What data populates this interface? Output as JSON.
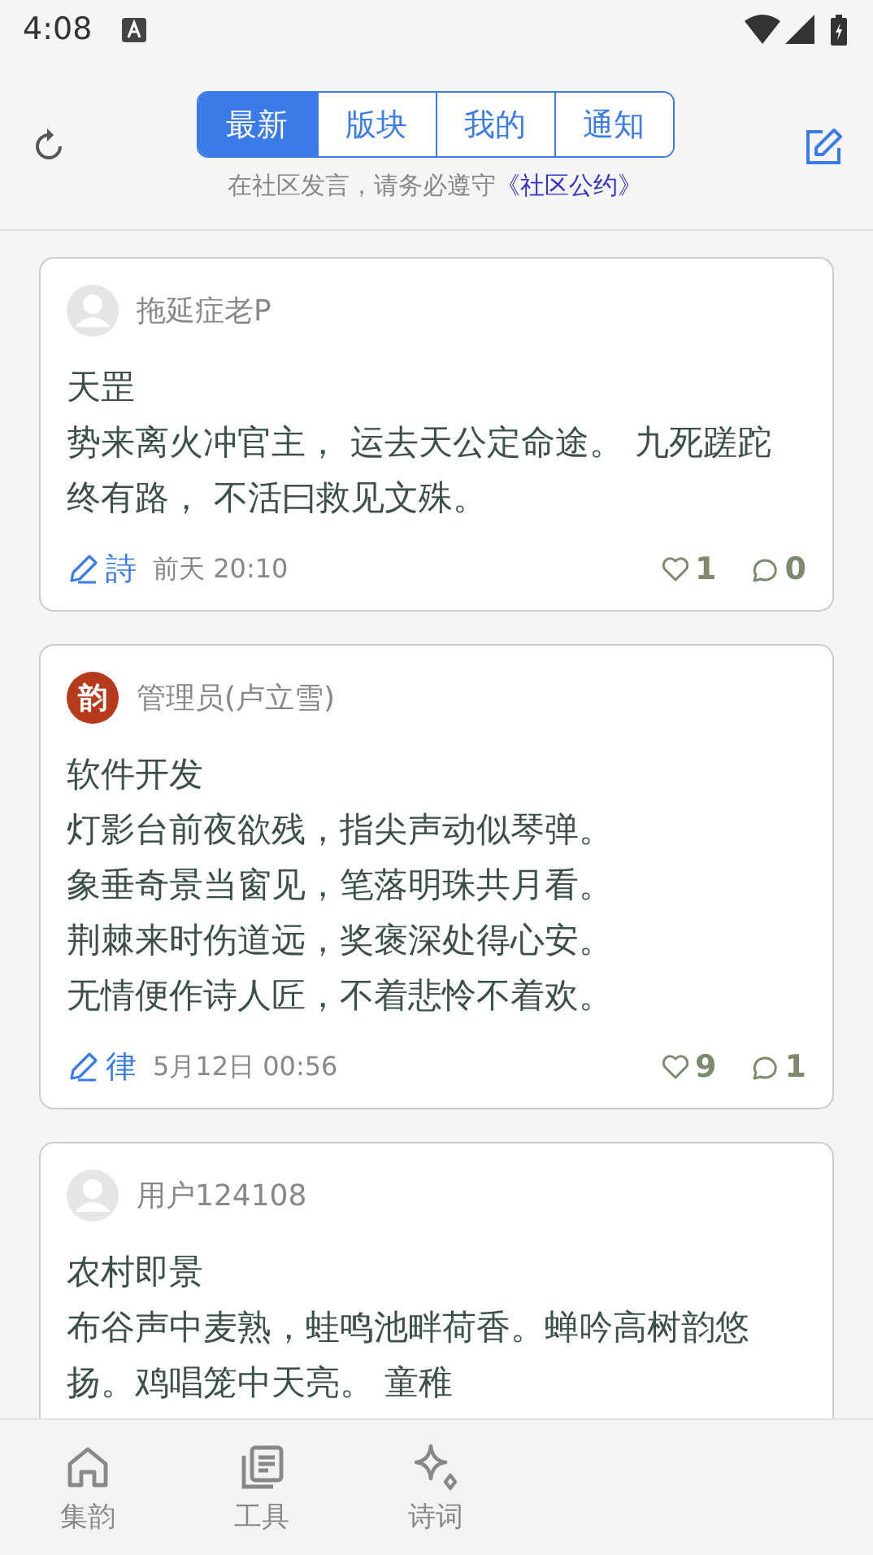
{
  "status_bar": {
    "time": "4:08"
  },
  "header": {
    "tabs": [
      {
        "label": "最新",
        "selected": true
      },
      {
        "label": "版块",
        "selected": false
      },
      {
        "label": "我的",
        "selected": false
      },
      {
        "label": "通知",
        "selected": false
      }
    ],
    "notice": "在社区发言，请务必遵守",
    "notice_link": "《社区公约》"
  },
  "posts": [
    {
      "avatar": {
        "kind": "default"
      },
      "author": "拖延症老P",
      "title": "天罡",
      "lines": [
        "势来离火冲官主， 运去天公定命途。 九死蹉跎终有路， 不活曰救见文殊。"
      ],
      "tag": "詩",
      "time": "前天 20:10",
      "likes": "1",
      "comments": "0"
    },
    {
      "avatar": {
        "kind": "seal",
        "text": "韵"
      },
      "author": "管理员(卢立雪)",
      "title": "软件开发",
      "lines": [
        "灯影台前夜欲残，指尖声动似琴弹。",
        "象垂奇景当窗见，笔落明珠共月看。",
        "荆棘来时伤道远，奖褒深处得心安。",
        "无情便作诗人匠，不着悲怜不着欢。"
      ],
      "tag": "律",
      "time": "5月12日 00:56",
      "likes": "9",
      "comments": "1"
    },
    {
      "avatar": {
        "kind": "default"
      },
      "author": "用户124108",
      "title": "农村即景",
      "lines": [
        "布谷声中麦熟，蛙鸣池畔荷香。蝉吟高树韵悠扬。鸡唱笼中天亮。 童稚"
      ]
    }
  ],
  "bottom_nav": [
    {
      "label": "集韵",
      "kind": "home",
      "selected": false
    },
    {
      "label": "工具",
      "kind": "book",
      "selected": false
    },
    {
      "label": "诗词",
      "kind": "sparkle",
      "selected": false
    }
  ]
}
